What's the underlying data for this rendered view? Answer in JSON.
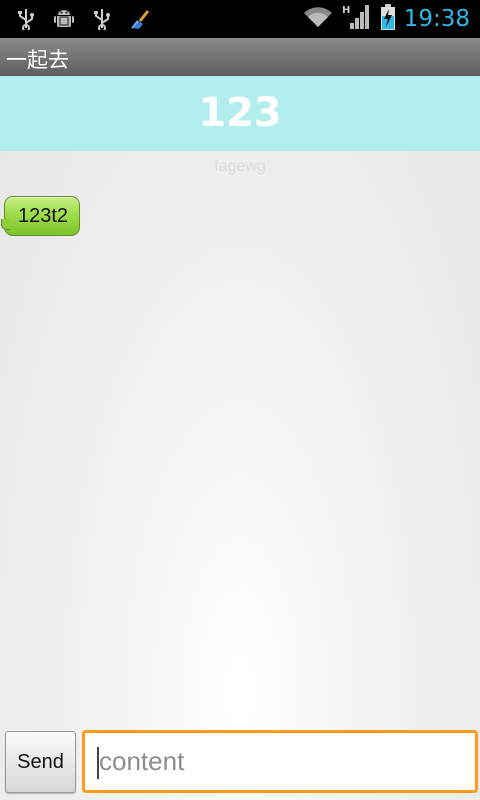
{
  "status_bar": {
    "time": "19:38",
    "icons": [
      "usb-icon",
      "android-debug-icon",
      "usb-icon",
      "cleaner-icon",
      "wifi-icon",
      "hspa-signal-icon",
      "battery-charging-icon"
    ],
    "network_type": "H",
    "accent_color": "#33b5e5"
  },
  "app": {
    "title": "一起去"
  },
  "header": {
    "title": "123",
    "subtitle": "fagewg",
    "background": "#b2eeee"
  },
  "messages": [
    {
      "text": "123t2",
      "bubble_color": "#9fdc4a"
    }
  ],
  "composer": {
    "send_label": "Send",
    "placeholder": "content",
    "value": "",
    "focus_color": "#ff9a1f"
  }
}
